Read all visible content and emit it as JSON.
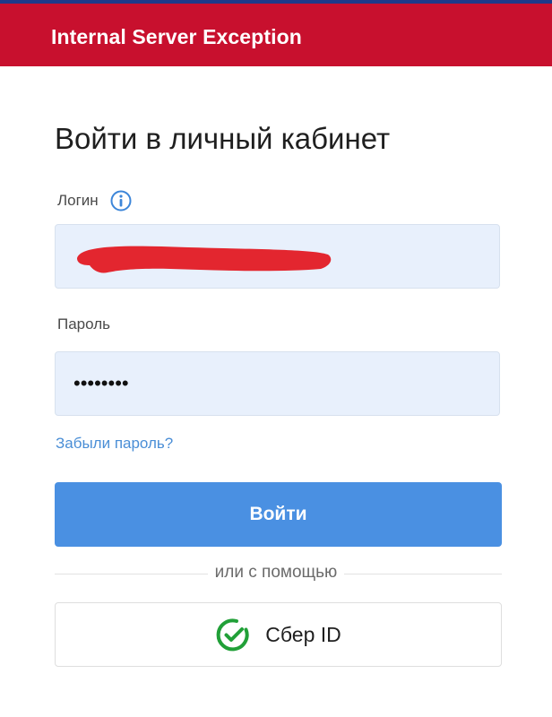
{
  "header": {
    "title": "Internal Server Exception"
  },
  "colors": {
    "header_bg": "#c8102e",
    "primary": "#4a90e2",
    "field_bg": "#e8f0fc",
    "link": "#4a8ed6",
    "sber_green": "#21a038",
    "redaction": "#e3262f"
  },
  "form": {
    "title": "Войти в личный кабинет",
    "login": {
      "label": "Логин",
      "info_icon": "info-icon",
      "value_redacted": true
    },
    "password": {
      "label": "Пароль",
      "value": "••••••••"
    },
    "forgot_link": "Забыли пароль?",
    "submit_label": "Войти"
  },
  "alt_login": {
    "divider_text": "или с помощью",
    "sber_label": "Сбер ID",
    "sber_icon": "sber-check-icon"
  }
}
